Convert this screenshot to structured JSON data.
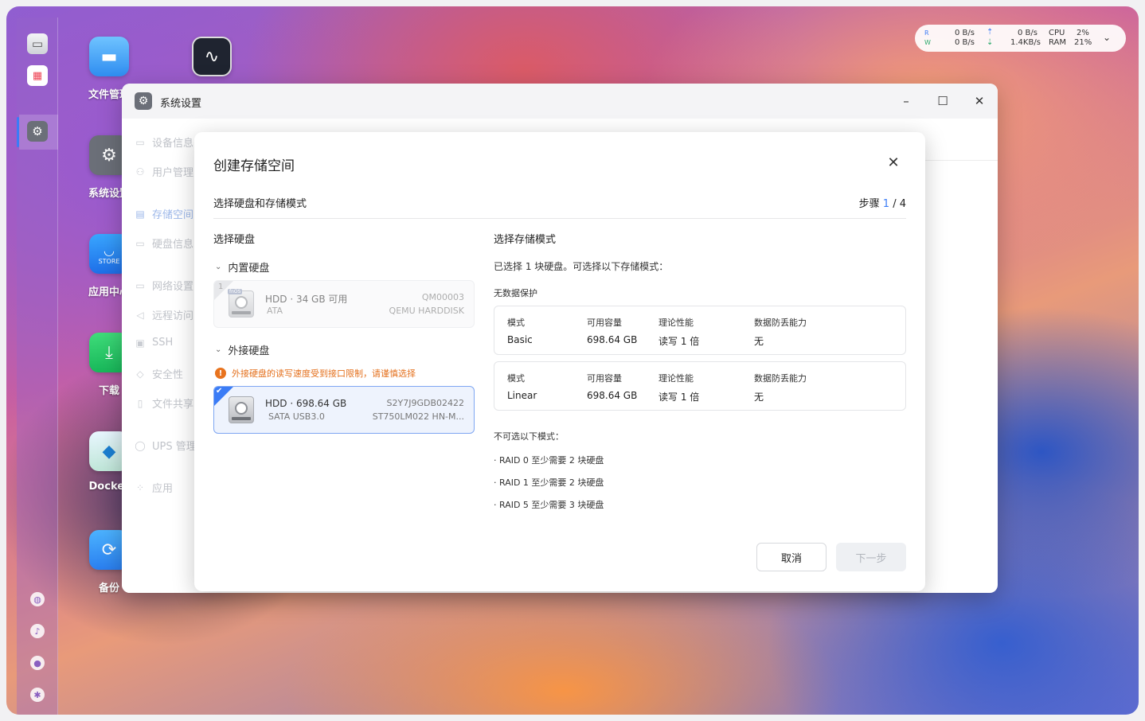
{
  "monitor": {
    "read_label": "R",
    "write_label": "W",
    "disk_read": "0  B/s",
    "disk_write": "0  B/s",
    "net_up": "0  B/s",
    "net_down": "1.4KB/s",
    "cpu_label": "CPU",
    "cpu_value": "2%",
    "ram_label": "RAM",
    "ram_value": "21%"
  },
  "desktop": {
    "apps": [
      {
        "label": "文件管理",
        "icon": "folder-icon"
      },
      {
        "label": "",
        "icon": "activity-monitor-icon"
      },
      {
        "label": "系统设置",
        "icon": "gear-icon"
      },
      {
        "label": "应用中心",
        "icon": "store-icon",
        "badge": "STORE"
      },
      {
        "label": "下载",
        "icon": "download-icon"
      },
      {
        "label": "Docker",
        "icon": "docker-icon"
      },
      {
        "label": "备份",
        "icon": "backup-icon"
      }
    ]
  },
  "window": {
    "title": "系统设置",
    "sidebar": [
      {
        "label": "设备信息",
        "icon": "device-icon"
      },
      {
        "label": "用户管理",
        "icon": "user-icon"
      },
      {
        "label": "存储空间",
        "icon": "storage-icon",
        "active": true
      },
      {
        "label": "硬盘信息",
        "icon": "disk-icon"
      },
      {
        "label": "网络设置",
        "icon": "network-icon"
      },
      {
        "label": "远程访问",
        "icon": "remote-icon"
      },
      {
        "label": "SSH",
        "icon": "ssh-icon"
      },
      {
        "label": "安全性",
        "icon": "shield-icon"
      },
      {
        "label": "文件共享",
        "icon": "share-icon"
      },
      {
        "label": "UPS 管理",
        "icon": "ups-icon"
      },
      {
        "label": "应用",
        "icon": "apps-icon"
      }
    ]
  },
  "dialog": {
    "title": "创建存储空间",
    "subtitle": "选择硬盘和存储模式",
    "steps_prefix": "步骤 ",
    "steps_current": "1",
    "steps_total": " / 4",
    "left": {
      "title": "选择硬盘",
      "internal_group": "内置硬盘",
      "internal_disk": {
        "index": "1",
        "tag": "fnOS",
        "line1": "HDD · 34 GB 可用",
        "line2": "ATA",
        "serial": "QM00003",
        "model": "QEMU HARDDISK"
      },
      "external_group": "外接硬盘",
      "warning": "外接硬盘的读写速度受到接口限制，请谨慎选择",
      "external_disk": {
        "line1": "HDD · 698.64 GB",
        "line2": "SATA USB3.0",
        "serial": "S2Y7J9GDB02422",
        "model": "ST750LM022 HN-M..."
      }
    },
    "right": {
      "title": "选择存储模式",
      "selected_info": "已选择 1 块硬盘。可选择以下存储模式：",
      "no_protection": "无数据保护",
      "headers": {
        "mode": "模式",
        "capacity": "可用容量",
        "performance": "理论性能",
        "protection": "数据防丢能力"
      },
      "modes": [
        {
          "mode": "Basic",
          "capacity": "698.64 GB",
          "performance": "读写 1 倍",
          "protection": "无"
        },
        {
          "mode": "Linear",
          "capacity": "698.64 GB",
          "performance": "读写 1 倍",
          "protection": "无"
        }
      ],
      "unavailable_title": "不可选以下模式：",
      "unavailable": [
        "· RAID 0   至少需要  2  块硬盘",
        "· RAID 1   至少需要  2  块硬盘",
        "· RAID 5   至少需要  3  块硬盘"
      ]
    },
    "cancel_label": "取消",
    "next_label": "下一步"
  }
}
